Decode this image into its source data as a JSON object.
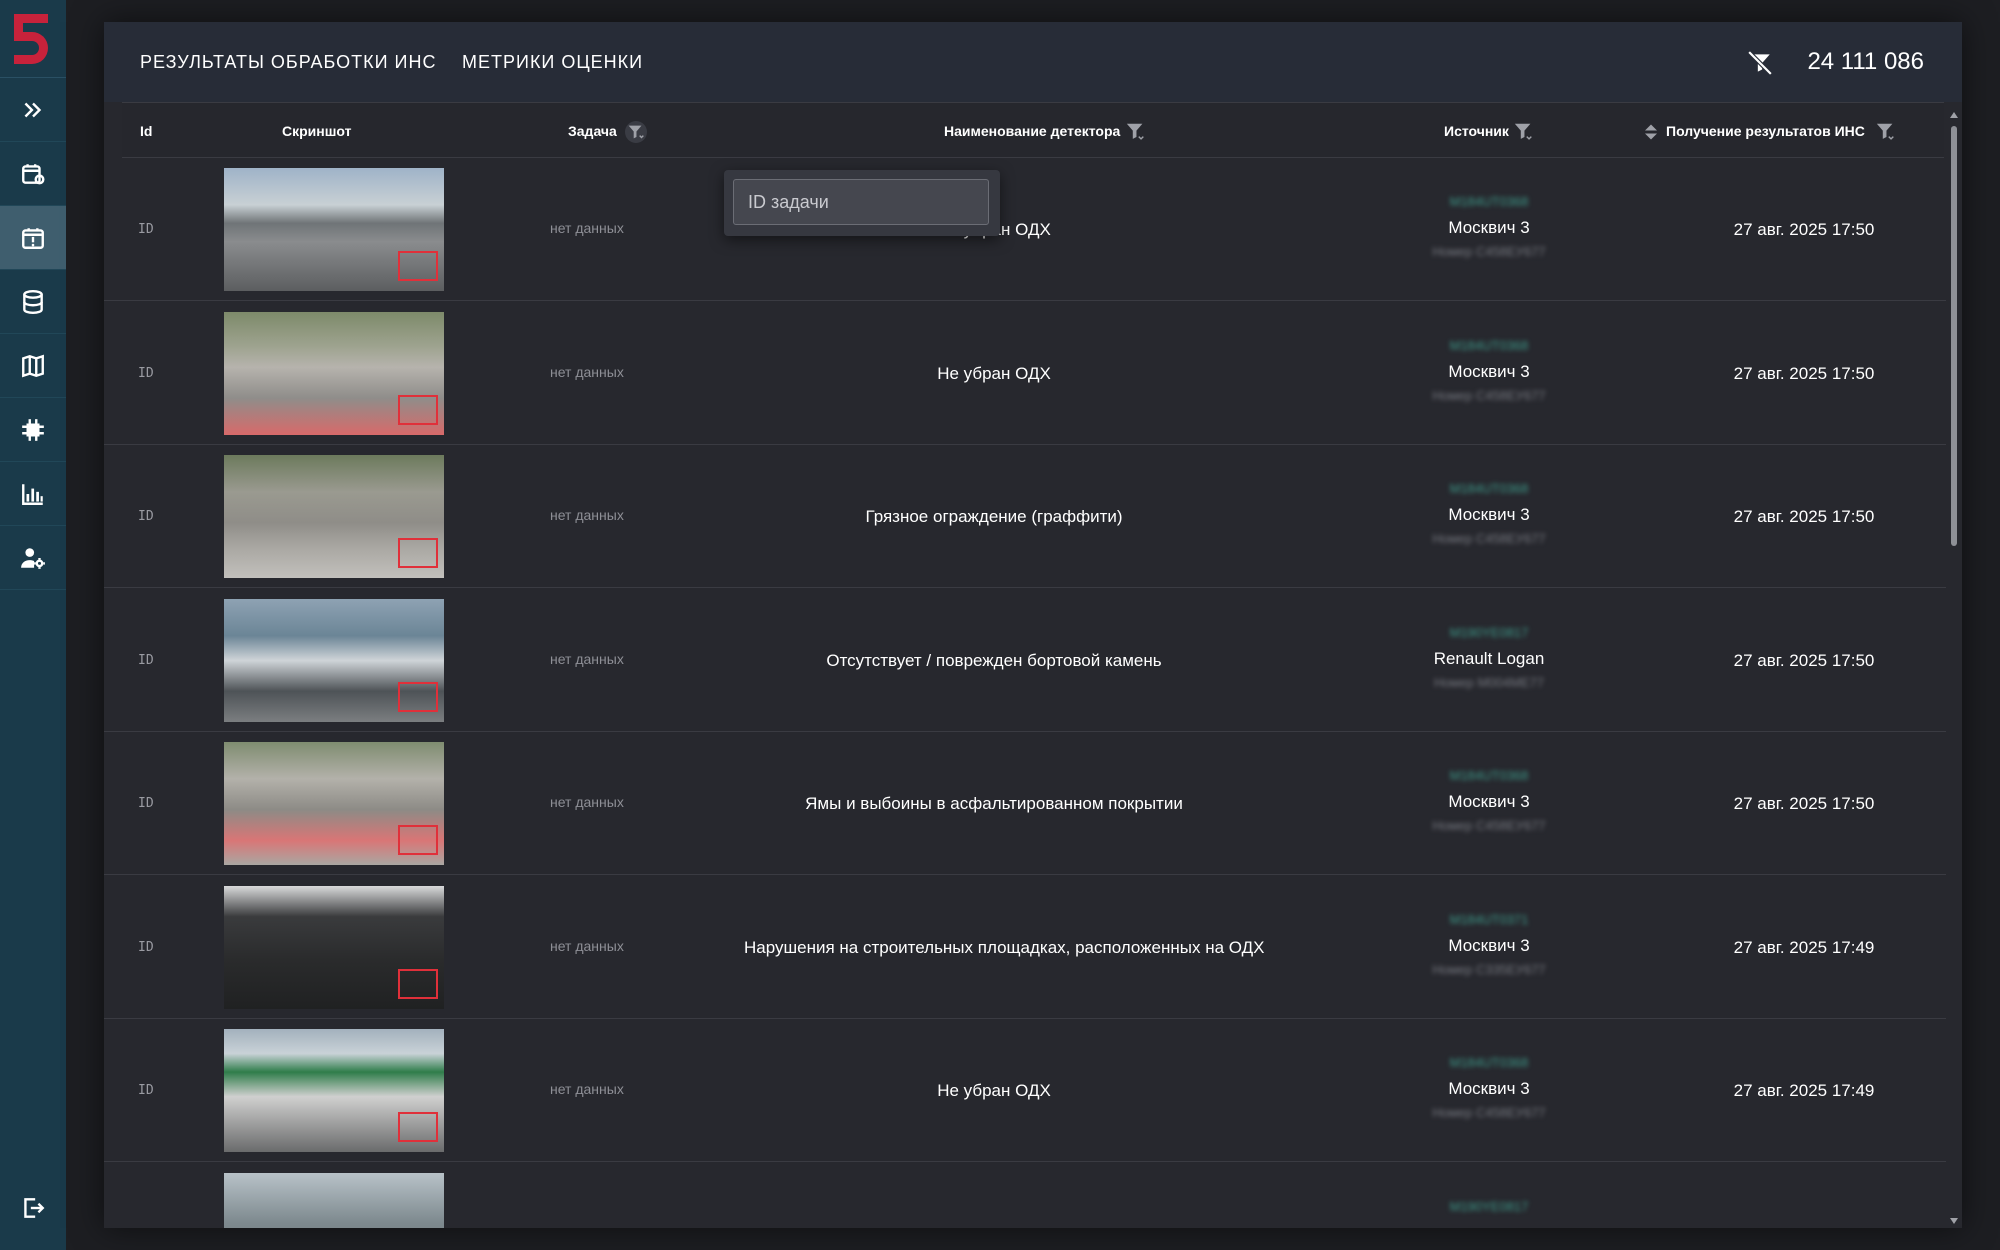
{
  "app": {
    "tabs": [
      "РЕЗУЛЬТАТЫ ОБРАБОТКИ ИНС",
      "МЕТРИКИ ОЦЕНКИ"
    ],
    "total_count": "24 111 086"
  },
  "sidebar": {
    "items": [
      {
        "name": "expand-icon"
      },
      {
        "name": "calendar-refresh-icon"
      },
      {
        "name": "calendar-alert-icon"
      },
      {
        "name": "database-icon"
      },
      {
        "name": "map-icon"
      },
      {
        "name": "chip-icon"
      },
      {
        "name": "bar-chart-icon"
      },
      {
        "name": "user-settings-icon"
      },
      {
        "name": "logout-icon"
      }
    ]
  },
  "table": {
    "columns": {
      "id": "Id",
      "screenshot": "Скриншот",
      "task": "Задача",
      "detector": "Наименование детектора",
      "source": "Источник",
      "received": "Получение результатов ИНС"
    },
    "task_filter_placeholder": "ID задачи",
    "rows": [
      {
        "id": "ID",
        "task": "нет данных",
        "detector": "Не убран ОДХ",
        "src_id": "M184UT0368",
        "src_name": "Москвич 3",
        "src_plate": "Номер С458ЕУ677",
        "time": "27 авг. 2025 17:50"
      },
      {
        "id": "ID",
        "task": "нет данных",
        "detector": "Не убран ОДХ",
        "src_id": "M184UT0368",
        "src_name": "Москвич 3",
        "src_plate": "Номер С458ЕУ677",
        "time": "27 авг. 2025 17:50"
      },
      {
        "id": "ID",
        "task": "нет данных",
        "detector": "Грязное ограждение (граффити)",
        "src_id": "M184UT0368",
        "src_name": "Москвич 3",
        "src_plate": "Номер С458ЕУ677",
        "time": "27 авг. 2025 17:50"
      },
      {
        "id": "ID",
        "task": "нет данных",
        "detector": "Отсутствует / поврежден бортовой камень",
        "src_id": "M190YE0817",
        "src_name": "Renault Logan",
        "src_plate": "Номер М004МЕ77",
        "time": "27 авг. 2025 17:50"
      },
      {
        "id": "ID",
        "task": "нет данных",
        "detector": "Ямы и выбоины в асфальтированном покрытии",
        "src_id": "M184UT0368",
        "src_name": "Москвич 3",
        "src_plate": "Номер С458ЕУ677",
        "time": "27 авг. 2025 17:50"
      },
      {
        "id": "ID",
        "task": "нет данных",
        "detector": "Нарушения на строительных площадках, расположенных на ОДХ",
        "src_id": "M184UT0371",
        "src_name": "Москвич 3",
        "src_plate": "Номер С335ЕУ677",
        "time": "27 авг. 2025 17:49"
      },
      {
        "id": "ID",
        "task": "нет данных",
        "detector": "Не убран ОДХ",
        "src_id": "M184UT0368",
        "src_name": "Москвич 3",
        "src_plate": "Номер С458ЕУ677",
        "time": "27 авг. 2025 17:49"
      },
      {
        "id": "",
        "task": "",
        "detector": "",
        "src_id": "M190YE0817",
        "src_name": "",
        "src_plate": "",
        "time": ""
      }
    ]
  },
  "colors": {
    "sidebar": "#1a3a4a",
    "accent_logo": "#c8223b",
    "panel": "#27282e",
    "source_id": "#3e9b8a"
  }
}
